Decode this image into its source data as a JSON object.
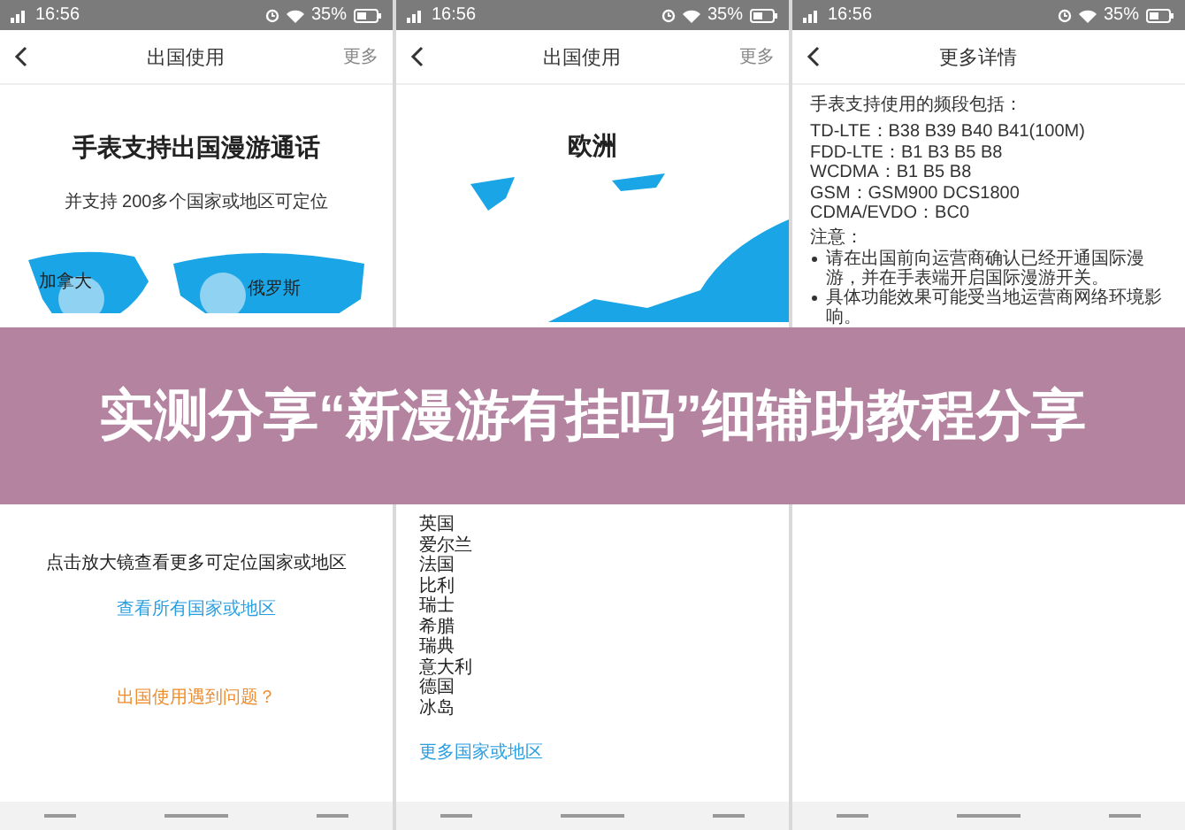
{
  "screens": [
    {
      "kind": "world",
      "status_bar": {
        "time": "16:56",
        "battery": "35%"
      },
      "header": {
        "title": "出国使用",
        "action": "更多"
      },
      "heading": "手表支持出国漫游通话",
      "subheading": "并支持 200多个国家或地区可定位",
      "map_labels": [
        "加拿大",
        "俄罗斯"
      ],
      "hint": "点击放大镜查看更多可定位国家或地区",
      "link": "查看所有国家或地区",
      "help_link": "出国使用遇到问题？"
    },
    {
      "kind": "region",
      "status_bar": {
        "time": "16:56",
        "battery": "35%"
      },
      "header": {
        "title": "出国使用",
        "action": "更多"
      },
      "heading": "欧洲",
      "countries": [
        "英国",
        "爱尔兰",
        "法国",
        "比利",
        "瑞士",
        "希腊",
        "瑞典",
        "意大利",
        "德国",
        "冰岛"
      ],
      "link": "更多国家或地区"
    },
    {
      "kind": "details",
      "status_bar": {
        "time": "16:56",
        "battery": "35%"
      },
      "header": {
        "title": "更多详情"
      },
      "heading": "手表支持使用的频段包括：",
      "bands": [
        "TD-LTE：B38 B39 B40 B41(100M)",
        "FDD-LTE：B1 B3 B5 B8",
        "WCDMA：B1 B5 B8",
        "GSM：GSM900  DCS1800",
        "CDMA/EVDO：BC0"
      ],
      "notes_title": "注意：",
      "notes": [
        "请在出国前向运营商确认已经开通国际漫游，并在手表端开启国际漫游开关。",
        "具体功能效果可能受当地运营商网络环境影响。"
      ]
    }
  ],
  "banner": {
    "title": "实测分享“新漫游有挂吗”细辅助教程分享"
  }
}
